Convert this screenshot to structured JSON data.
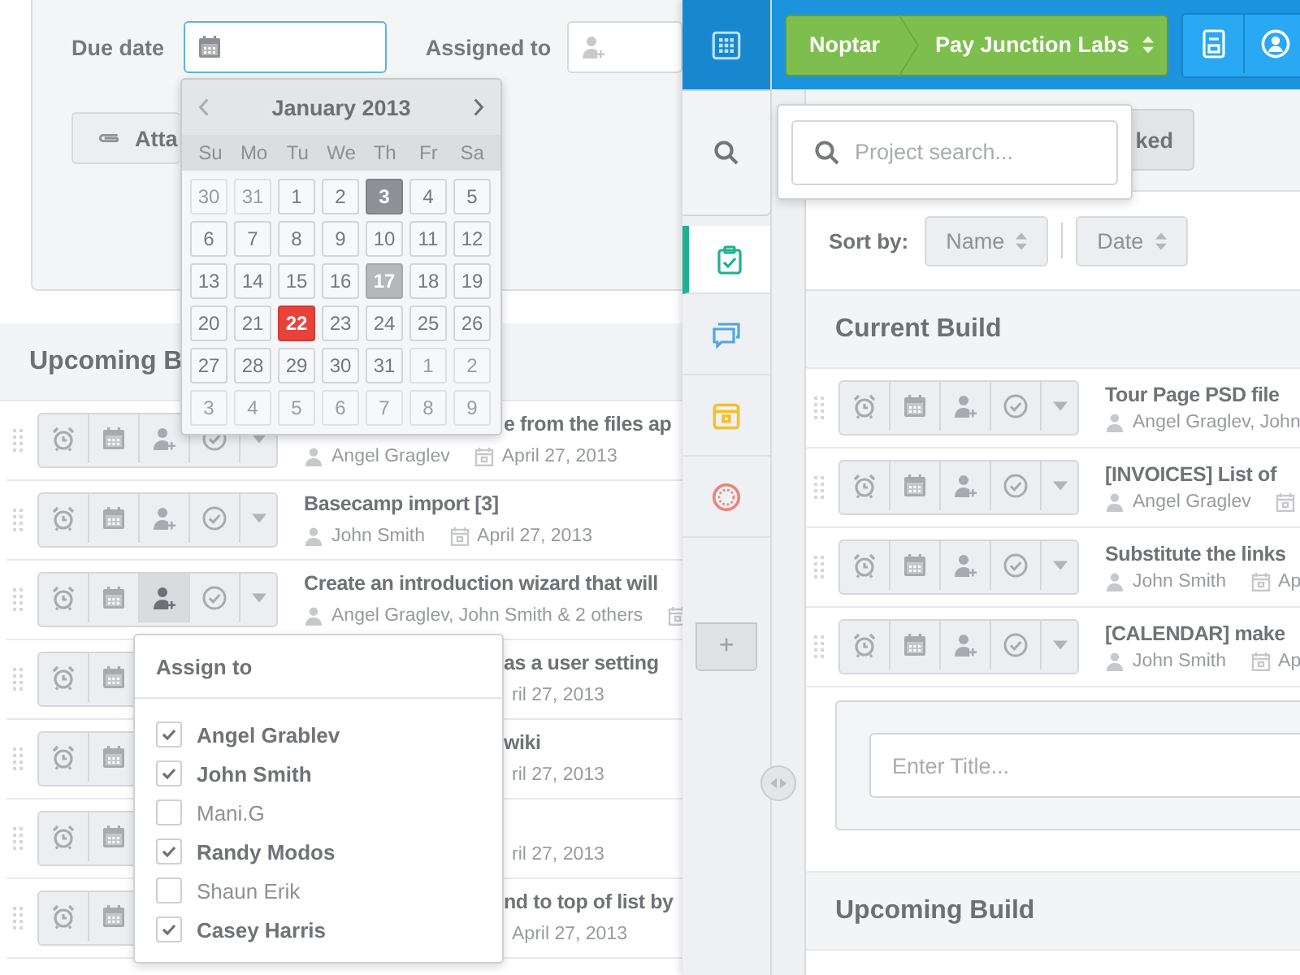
{
  "form": {
    "due_date_label": "Due date",
    "assigned_label": "Assigned to",
    "attach_button": "Atta"
  },
  "calendar": {
    "month": "January 2013",
    "weekdays": [
      "Su",
      "Mo",
      "Tu",
      "We",
      "Th",
      "Fr",
      "Sa"
    ],
    "days": [
      {
        "label": "30",
        "kind": "outside"
      },
      {
        "label": "31",
        "kind": "outside"
      },
      {
        "label": "1",
        "kind": "normal"
      },
      {
        "label": "2",
        "kind": "normal"
      },
      {
        "label": "3",
        "kind": "marked"
      },
      {
        "label": "4",
        "kind": "normal"
      },
      {
        "label": "5",
        "kind": "normal"
      },
      {
        "label": "6",
        "kind": "normal"
      },
      {
        "label": "7",
        "kind": "normal"
      },
      {
        "label": "8",
        "kind": "normal"
      },
      {
        "label": "9",
        "kind": "normal"
      },
      {
        "label": "10",
        "kind": "normal"
      },
      {
        "label": "11",
        "kind": "normal"
      },
      {
        "label": "12",
        "kind": "normal"
      },
      {
        "label": "13",
        "kind": "normal"
      },
      {
        "label": "14",
        "kind": "normal"
      },
      {
        "label": "15",
        "kind": "normal"
      },
      {
        "label": "16",
        "kind": "normal"
      },
      {
        "label": "17",
        "kind": "marked-light"
      },
      {
        "label": "18",
        "kind": "normal"
      },
      {
        "label": "19",
        "kind": "normal"
      },
      {
        "label": "20",
        "kind": "normal"
      },
      {
        "label": "21",
        "kind": "normal"
      },
      {
        "label": "22",
        "kind": "today"
      },
      {
        "label": "23",
        "kind": "normal"
      },
      {
        "label": "24",
        "kind": "normal"
      },
      {
        "label": "25",
        "kind": "normal"
      },
      {
        "label": "26",
        "kind": "normal"
      },
      {
        "label": "27",
        "kind": "normal"
      },
      {
        "label": "28",
        "kind": "normal"
      },
      {
        "label": "29",
        "kind": "normal"
      },
      {
        "label": "30",
        "kind": "normal"
      },
      {
        "label": "31",
        "kind": "normal"
      },
      {
        "label": "1",
        "kind": "outside"
      },
      {
        "label": "2",
        "kind": "outside"
      },
      {
        "label": "3",
        "kind": "outside"
      },
      {
        "label": "4",
        "kind": "outside"
      },
      {
        "label": "5",
        "kind": "outside"
      },
      {
        "label": "6",
        "kind": "outside"
      },
      {
        "label": "7",
        "kind": "outside"
      },
      {
        "label": "8",
        "kind": "outside"
      },
      {
        "label": "9",
        "kind": "outside"
      }
    ]
  },
  "upcoming_list": {
    "heading": "Upcoming B",
    "tasks": [
      {
        "title": "e from the files ap",
        "assignees": "Angel Graglev",
        "date": "April 27, 2013",
        "date_icon": true,
        "assign_open": false
      },
      {
        "title": "Basecamp import [3]",
        "assignees": "John Smith",
        "date": "April 27, 2013",
        "date_icon": true,
        "assign_open": false
      },
      {
        "title": "Create an introduction wizard that will",
        "assignees": "Angel Graglev, John Smith & 2 others",
        "date_icon": true,
        "assign_open": true
      },
      {
        "title": "as a user setting",
        "date": "ril 27, 2013",
        "date_icon": false,
        "assign_open": false
      },
      {
        "title": "wiki",
        "date": "ril 27, 2013",
        "date_icon": false,
        "assign_open": false
      },
      {
        "date": "ril 27, 2013",
        "date_icon": false,
        "assign_open": false
      },
      {
        "title": "nd to top of list by",
        "date": "April 27, 2013",
        "date_icon": false,
        "assign_open": false
      }
    ]
  },
  "assign_menu": {
    "title": "Assign to",
    "people": [
      {
        "name": "Angel Grablev",
        "checked": true
      },
      {
        "name": "John Smith",
        "checked": true
      },
      {
        "name": "Mani.G",
        "checked": false
      },
      {
        "name": "Randy Modos",
        "checked": true
      },
      {
        "name": "Shaun Erik",
        "checked": false
      },
      {
        "name": "Casey Harris",
        "checked": true
      }
    ]
  },
  "sidebar": {
    "items": [
      {
        "kind": "search",
        "selected": false,
        "expanded": true
      },
      {
        "kind": "tasks",
        "selected": true,
        "expanded": false
      },
      {
        "kind": "chat",
        "selected": false,
        "expanded": false
      },
      {
        "kind": "calendar",
        "selected": false,
        "expanded": false
      },
      {
        "kind": "timer",
        "selected": false,
        "expanded": false
      }
    ],
    "add_button": "+"
  },
  "topbar": {
    "organization": "Noptar",
    "project": "Pay Junction Labs"
  },
  "project_search": {
    "placeholder": "Project search..."
  },
  "filter_button": "ked",
  "sort": {
    "label": "Sort by:",
    "options": [
      "Name",
      "Date"
    ]
  },
  "current_build": {
    "heading": "Current Build",
    "tasks": [
      {
        "title": "Tour Page PSD file",
        "assignees": "Angel Graglev, John",
        "date_icon": false
      },
      {
        "title": "[INVOICES] List of",
        "assignees": "Angel Graglev",
        "date_icon": true
      },
      {
        "title": "Substitute the links",
        "assignees": "John Smith",
        "date": "Ap",
        "date_icon": true
      },
      {
        "title": "[CALENDAR] make",
        "assignees": "John Smith",
        "date": "Ap",
        "date_icon": true
      }
    ],
    "new_task_placeholder": "Enter Title..."
  },
  "upcoming_build": {
    "heading": "Upcoming Build"
  }
}
